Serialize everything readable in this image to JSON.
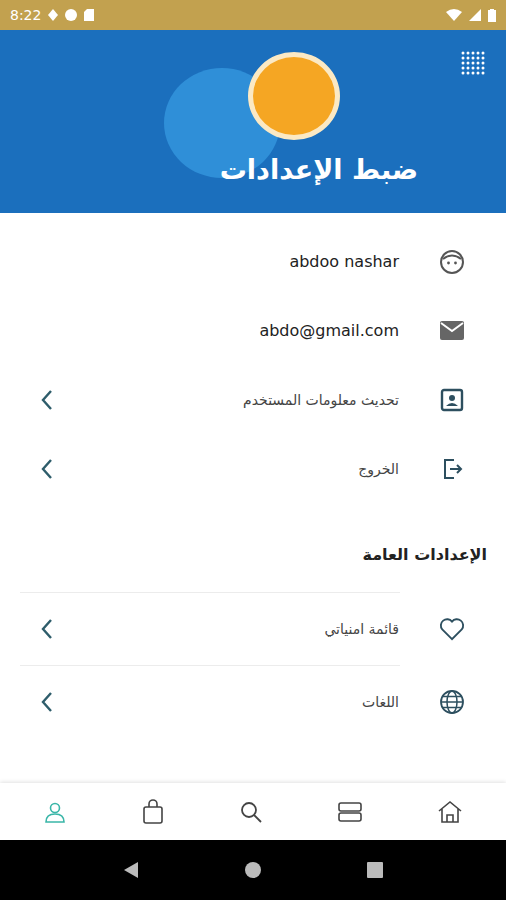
{
  "status_bar": {
    "time": "8:22"
  },
  "header": {
    "title": "ضبط الإعدادات"
  },
  "account": [
    {
      "text": "abdoo nashar",
      "kind": "info"
    },
    {
      "text": "abdo@gmail.com",
      "kind": "info"
    },
    {
      "text": "تحديث معلومات المستخدم",
      "kind": "link"
    },
    {
      "text": "الخروج",
      "kind": "link"
    }
  ],
  "general": {
    "title": "الإعدادات العامة",
    "items": [
      {
        "text": "قائمة امنياتي",
        "kind": "link"
      },
      {
        "text": "اللغات",
        "kind": "link"
      }
    ]
  },
  "bottom_nav": [
    {
      "selected": true
    },
    {
      "selected": false
    },
    {
      "selected": false
    },
    {
      "selected": false
    },
    {
      "selected": false
    }
  ]
}
